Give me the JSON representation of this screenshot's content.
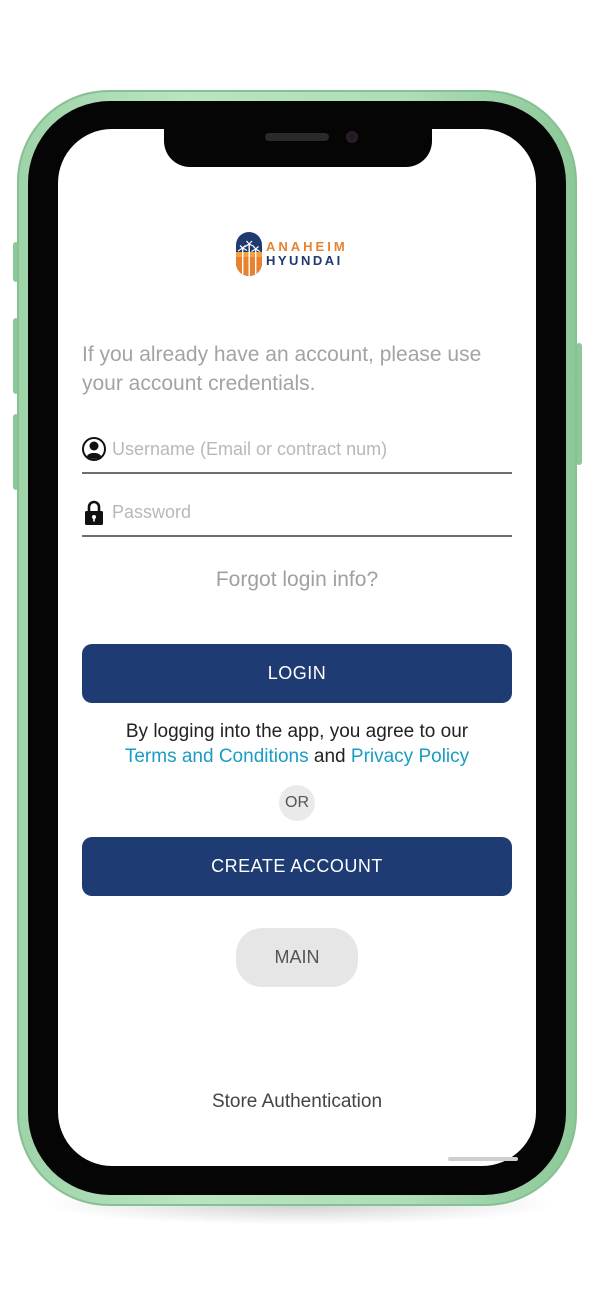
{
  "logo": {
    "line1": "ANAHEIM",
    "line2": "HYUNDAI",
    "icon": "palm-tree-badge-icon",
    "colors": {
      "orange": "#e8822e",
      "navy": "#1f3a6e"
    }
  },
  "intro_text": "If you already have an account, please use your account credentials.",
  "username": {
    "icon": "user-silhouette-icon",
    "placeholder": "Username (Email or contract num)",
    "value": ""
  },
  "password": {
    "icon": "lock-icon",
    "placeholder": "Password",
    "value": ""
  },
  "forgot_label": "Forgot login info?",
  "login_label": "LOGIN",
  "agreement": {
    "prefix": "By logging into the app, you agree to our",
    "terms_link": "Terms and Conditions",
    "conjunction": "and",
    "privacy_link": "Privacy Policy"
  },
  "or_label": "OR",
  "create_account_label": "CREATE ACCOUNT",
  "main_label": "MAIN",
  "footer_text": "Store Authentication",
  "colors": {
    "primary_button": "#1e3c73",
    "link": "#1a9cc4",
    "secondary_button": "#e6e6e6",
    "phone_frame": "#aeddb7"
  }
}
